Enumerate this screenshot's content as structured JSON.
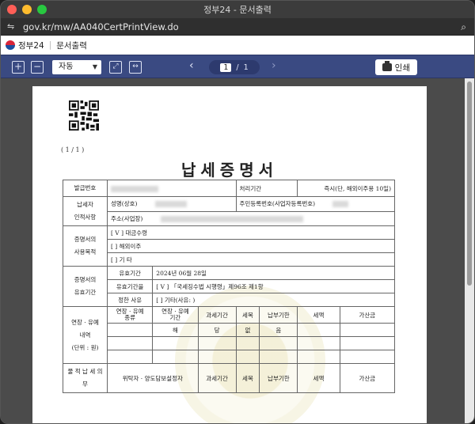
{
  "window": {
    "title": "정부24 - 문서출력"
  },
  "urlbar": {
    "url": "gov.kr/mw/AA040CertPrintView.do"
  },
  "site": {
    "name": "정부24",
    "section": "문서출력"
  },
  "toolbar": {
    "zoom_value": "자동",
    "page_current": "1",
    "page_sep": "/",
    "page_total": "1",
    "print_label": "인쇄"
  },
  "document": {
    "page_indicator": "( 1 / 1 )",
    "title": "납세증명서",
    "row_issue": {
      "label": "발급번호",
      "proc_label": "처리기간",
      "proc_value": "즉시(단, 해외이주용 10일)"
    },
    "taxpayer": {
      "label": "납세자\n인적사항",
      "name_label": "성명(상호)",
      "id_label": "주민등록번호(사업자등록번호)",
      "addr_label": "주소(사업장)"
    },
    "purpose": {
      "label": "증명서의\n사용목적",
      "opt1": "[ V ]  대금수령",
      "opt2": "[   ]  해외이주",
      "opt3": "[   ]  기        타"
    },
    "validity": {
      "label": "증명서의\n유효기간",
      "period_label": "유효기간",
      "period_value": "2024년 06월 28일",
      "reason_label": "유효기간을",
      "reason_value": "[ V ] 「국세징수법 시행령」제96조 제1항",
      "reason_label2": "정한 사유",
      "reason_value2": "[   ]  기타(사유:                            )"
    },
    "deferral": {
      "label": "연장 · 유예\n내역\n(단위 : 원)",
      "col1": "연장 · 유예\n종류",
      "col2": "연장 · 유예\n기간",
      "col3": "과세기간",
      "col4": "세목",
      "col5": "납부기한",
      "col6": "세액",
      "col7": "가산금",
      "empty_marks": [
        "해",
        "당",
        "없",
        "음"
      ]
    },
    "seizure": {
      "label": "물 적 납 세 의 무",
      "col1": "위탁자 · 양도담보설정자",
      "col3": "과세기간",
      "col4": "세목",
      "col5": "납부기한",
      "col6": "세액",
      "col7": "가산금"
    }
  },
  "colors": {
    "toolbar": "#3a4a82",
    "paper": "#ffffff",
    "viewer_bg": "#4b4b4b"
  }
}
